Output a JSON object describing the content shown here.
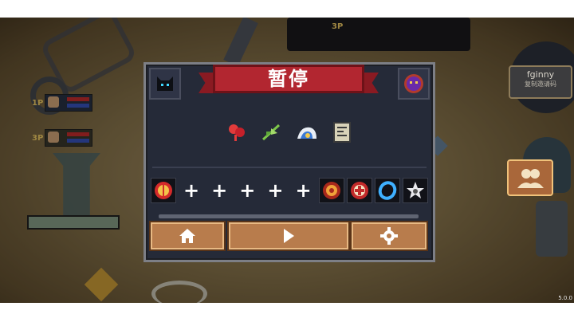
{
  "pause_menu": {
    "title": "暂停",
    "character_icon": "black-cat-icon",
    "boss_icon": "purple-boss-icon",
    "buffs": [
      "red-feather-icon",
      "green-leaves-icon",
      "blue-wave-icon",
      "scroll-note-icon"
    ],
    "slots": [
      {
        "icon": "red-shield-icon",
        "kind": "item"
      },
      {
        "icon": "plus-icon",
        "kind": "empty",
        "label": "+"
      },
      {
        "icon": "plus-icon",
        "kind": "empty",
        "label": "+"
      },
      {
        "icon": "plus-icon",
        "kind": "empty",
        "label": "+"
      },
      {
        "icon": "plus-icon",
        "kind": "empty",
        "label": "+"
      },
      {
        "icon": "plus-icon",
        "kind": "empty",
        "label": "+"
      },
      {
        "icon": "fire-shield-icon",
        "kind": "item"
      },
      {
        "icon": "medic-badge-icon",
        "kind": "item"
      },
      {
        "icon": "blue-ring-icon",
        "kind": "item"
      },
      {
        "icon": "star-emblem-icon",
        "kind": "item"
      }
    ],
    "buttons": {
      "home": "home-icon",
      "resume": "play-icon",
      "settings": "gear-icon"
    }
  },
  "players": [
    {
      "tag": "1P"
    },
    {
      "tag": "3P"
    }
  ],
  "top_tag": "3P",
  "name_tag": {
    "name": "fginny",
    "sub": "复制邀请码"
  },
  "version": "5.0.0",
  "colors": {
    "banner": "#b22630",
    "button": "#b87c4c",
    "panel": "#252a38"
  }
}
